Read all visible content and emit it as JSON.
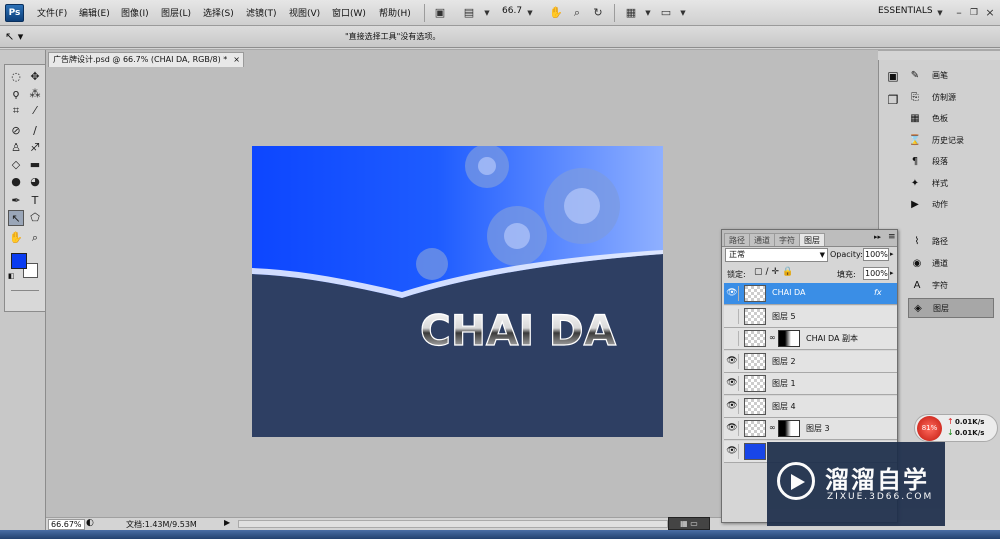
{
  "app": {
    "logo": "Ps"
  },
  "menu": [
    "文件(F)",
    "编辑(E)",
    "图像(I)",
    "图层(L)",
    "选择(S)",
    "滤镜(T)",
    "视图(V)",
    "窗口(W)",
    "帮助(H)"
  ],
  "toolbar": {
    "zoom": "66.7",
    "workspace": "ESSENTIALS"
  },
  "options_bar": {
    "message": "\"直接选择工具\"没有选项。"
  },
  "document": {
    "tab_title": "广告牌设计.psd @ 66.7% (CHAI DA, RGB/8) *",
    "canvas_text": "CHAI DA"
  },
  "status": {
    "zoom": "66.67%",
    "doc_info": "文档:1.43M/9.53M"
  },
  "colors": {
    "foreground": "#0a3cf0",
    "background": "#ffffff",
    "canvas_top": "#1e52ff",
    "canvas_bottom": "#2e3f63",
    "selected_layer": "#3a8ee6"
  },
  "dock_upper": [
    {
      "icon": "brush-icon",
      "label": "画笔"
    },
    {
      "icon": "clone-source-icon",
      "label": "仿制源"
    },
    {
      "icon": "swatches-icon",
      "label": "色板"
    },
    {
      "icon": "history-icon",
      "label": "历史记录"
    },
    {
      "icon": "paragraph-icon",
      "label": "段落"
    },
    {
      "icon": "styles-icon",
      "label": "样式"
    },
    {
      "icon": "actions-icon",
      "label": "动作"
    }
  ],
  "dock_lower": [
    {
      "icon": "paths-icon",
      "label": "路径"
    },
    {
      "icon": "channels-icon",
      "label": "通道"
    },
    {
      "icon": "character-icon",
      "label": "字符"
    },
    {
      "icon": "layers-icon",
      "label": "图层"
    }
  ],
  "layers_panel": {
    "tabs": [
      "路径",
      "通道",
      "字符",
      "图层"
    ],
    "blend_mode": "正常",
    "opacity_label": "Opacity:",
    "opacity": "100%",
    "lock_label": "锁定:",
    "fill_label": "填充:",
    "fill": "100%",
    "layers": [
      {
        "name": "CHAI DA",
        "visible": true,
        "selected": true,
        "fx": "fx"
      },
      {
        "name": "图层 5",
        "visible": false
      },
      {
        "name": "CHAI DA 副本",
        "visible": false,
        "mask": true
      },
      {
        "name": "图层 2",
        "visible": true
      },
      {
        "name": "图层 1",
        "visible": true
      },
      {
        "name": "图层 4",
        "visible": true
      },
      {
        "name": "图层 3",
        "visible": true,
        "mask": true
      },
      {
        "name": "",
        "visible": true,
        "fill": "#1846e8"
      }
    ]
  },
  "net_widget": {
    "percent": "81%",
    "up": "0.01K/s",
    "down": "0.01K/s"
  },
  "watermark": {
    "title": "溜溜自学",
    "url": "ZIXUE.3D66.COM"
  }
}
